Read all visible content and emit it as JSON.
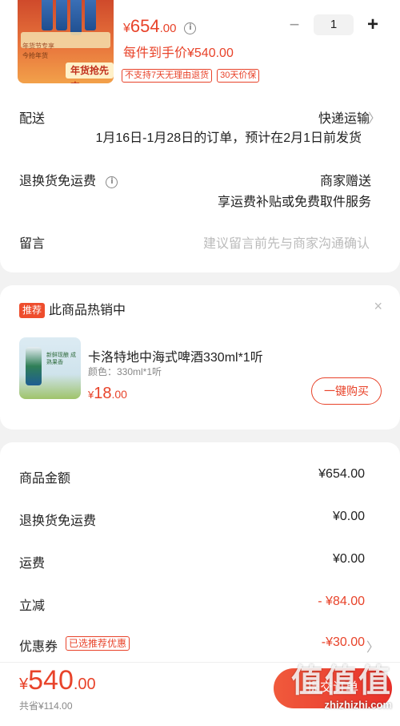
{
  "product": {
    "promo_line1": "年货节专享",
    "promo_line2": "今抢年货",
    "banner": "年货抢先屯",
    "price_yen": "¥",
    "price_int": "654",
    "price_dec": ".00",
    "unit_price": "每件到手价¥540.00",
    "tags": [
      "不支持7天无理由退货",
      "30天价保"
    ],
    "qty_minus": "−",
    "quantity": "1",
    "qty_plus": "+",
    "info_icon": "i"
  },
  "delivery": {
    "label": "配送",
    "method": "快递运输",
    "note": "1月16日-1月28日的订单，预计在2月1日前发货"
  },
  "return_shipping": {
    "label": "退换货免运费",
    "value": "商家赠送",
    "sub": "享运费补贴或免费取件服务"
  },
  "message": {
    "label": "留言",
    "placeholder": "建议留言前先与商家沟通确认"
  },
  "recommend": {
    "badge": "推荐",
    "title": "此商品热销中",
    "close": "×",
    "img_text": "新鲜现酿 成熟果香",
    "name": "卡洛特地中海式啤酒330ml*1听",
    "spec": "颜色：330ml*1听",
    "price_yen": "¥",
    "price_int": "18",
    "price_dec": ".00",
    "buy_label": "一键购买"
  },
  "summary": {
    "rows": [
      {
        "label": "商品金额",
        "value": "¥654.00"
      },
      {
        "label": "退换货免运费",
        "value": "¥0.00"
      },
      {
        "label": "运费",
        "value": "¥0.00"
      },
      {
        "label": "立减",
        "value": "- ¥84.00"
      },
      {
        "label": "优惠券",
        "value": "-¥30.00"
      }
    ],
    "coupon_tag": "已选推荐优惠"
  },
  "footer": {
    "total_yen": "¥",
    "total_int": "540",
    "total_dec": ".00",
    "saved": "共省¥114.00",
    "submit_label": "提交订单"
  },
  "watermark": {
    "big": "值值值",
    "small": "zhizhizhi.com"
  },
  "colors": {
    "accent": "#e8432a",
    "background": "#f2f2f2"
  }
}
